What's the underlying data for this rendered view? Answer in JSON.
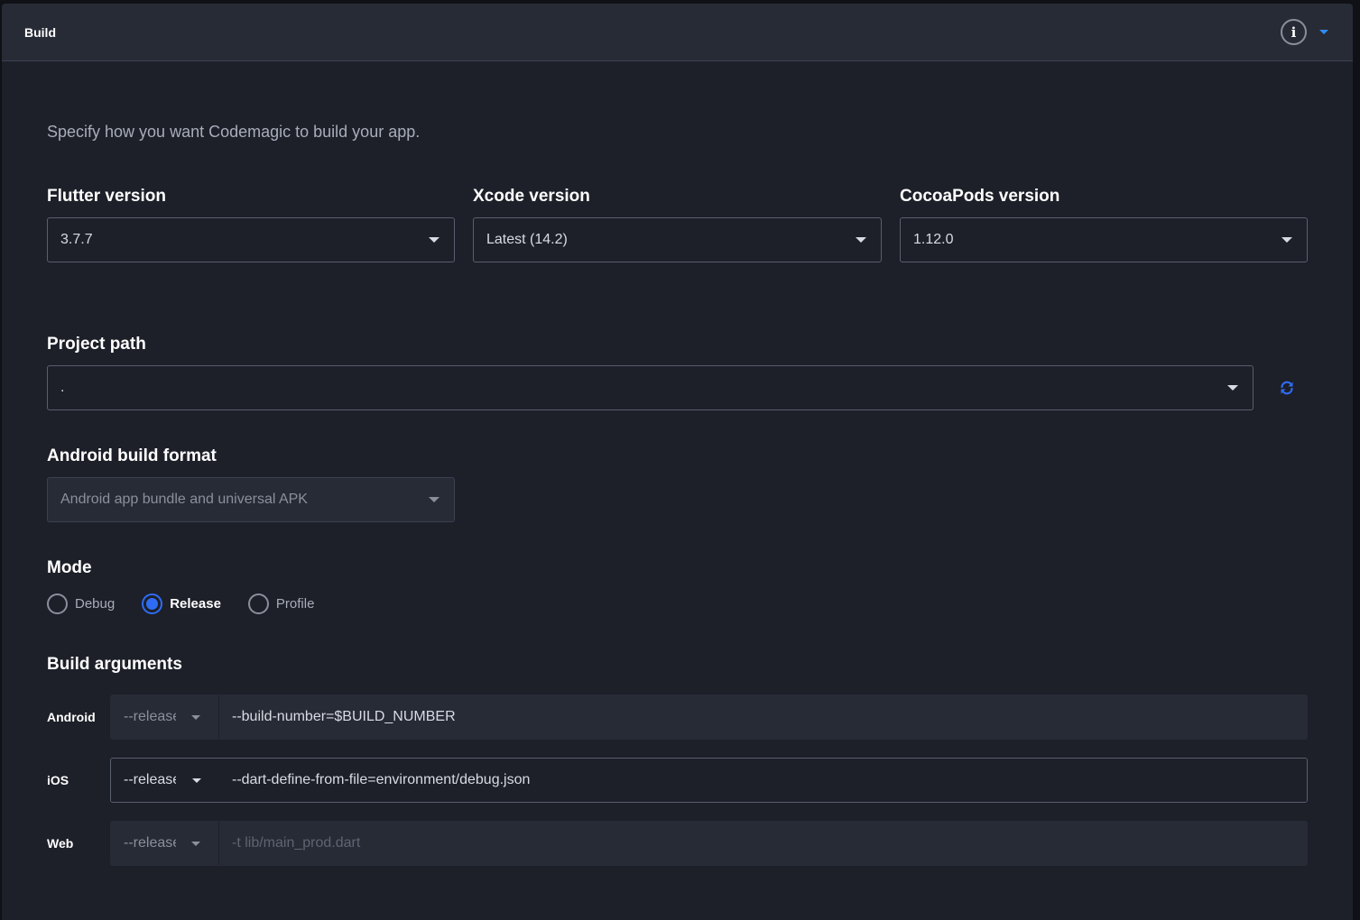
{
  "header": {
    "title": "Build",
    "info_icon": "i"
  },
  "intro_text": "Specify how you want Codemagic to build your app.",
  "versions": {
    "flutter": {
      "label": "Flutter version",
      "value": "3.7.7"
    },
    "xcode": {
      "label": "Xcode version",
      "value": "Latest (14.2)"
    },
    "cocoapods": {
      "label": "CocoaPods version",
      "value": "1.12.0"
    }
  },
  "project_path": {
    "label": "Project path",
    "value": "."
  },
  "android_format": {
    "label": "Android build format",
    "value": "Android app bundle and universal APK"
  },
  "mode": {
    "label": "Mode",
    "options": [
      "Debug",
      "Release",
      "Profile"
    ],
    "selected": "Release"
  },
  "build_arguments": {
    "label": "Build arguments",
    "rows": [
      {
        "platform": "Android",
        "mode": "--release",
        "value": "--build-number=$BUILD_NUMBER"
      },
      {
        "platform": "iOS",
        "mode": "--release",
        "value": "--dart-define-from-file=environment/debug.json"
      },
      {
        "platform": "Web",
        "mode": "--release",
        "placeholder": "-t lib/main_prod.dart"
      }
    ]
  },
  "colors": {
    "accent": "#2f6cf5",
    "panel_bg": "#1d2029",
    "header_bg": "#272b36"
  }
}
